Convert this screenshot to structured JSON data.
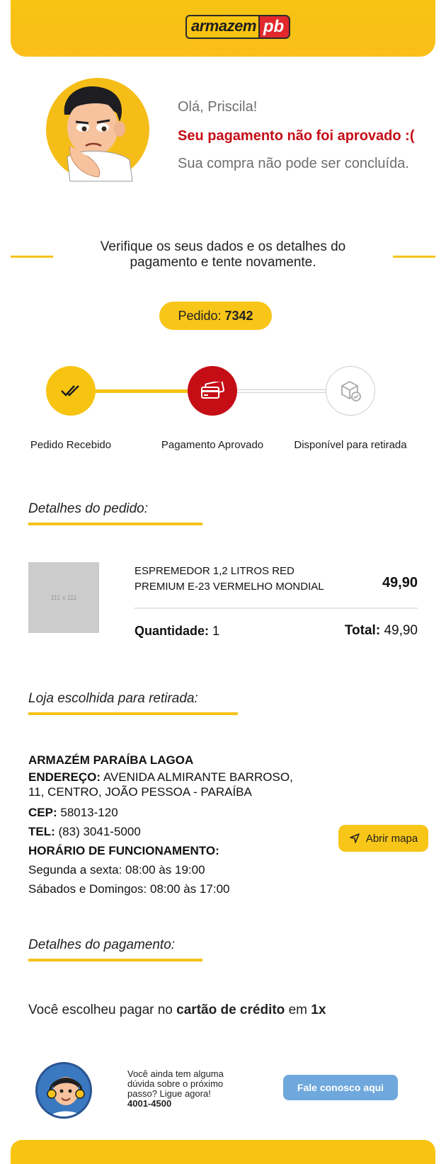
{
  "header": {
    "logo_main": "armazem",
    "logo_suffix": "pb"
  },
  "hero": {
    "greeting": "Olá, Priscila!",
    "status": "Seu pagamento não foi aprovado :(",
    "message": "Sua compra não pode ser concluída."
  },
  "notice": {
    "line1": "Verifique os seus dados e os detalhes do",
    "line2": "pagamento e tente novamente."
  },
  "order": {
    "label": "Pedido:",
    "number": "7342"
  },
  "tracking": {
    "steps": [
      {
        "label": "Pedido Recebido",
        "state": "done",
        "color": "#f7c412"
      },
      {
        "label": "Pagamento Aprovado",
        "state": "error",
        "color": "#c50d16"
      },
      {
        "label": "Disponível para retirada",
        "state": "pending",
        "color": "#ffffff"
      }
    ]
  },
  "order_details": {
    "title": "Detalhes do pedido:",
    "thumb_placeholder": "111 x 111",
    "product_line1": "ESPREMEDOR 1,2 LITROS RED",
    "product_line2": "PREMIUM E-23 VERMELHO MONDIAL",
    "price": "49,90",
    "quantity_label": "Quantidade:",
    "quantity": "1",
    "total_label": "Total:",
    "total": "49,90"
  },
  "store": {
    "title": "Loja escolhida para retirada:",
    "name": "ARMAZÉM PARAÍBA LAGOA",
    "address_label": "ENDEREÇO:",
    "address_line1": "AVENIDA ALMIRANTE BARROSO,",
    "address_line2": "11, CENTRO, JOÃO PESSOA - PARAÍBA",
    "cep_label": "CEP:",
    "cep": "58013-120",
    "tel_label": "TEL:",
    "tel": "(83) 3041-5000",
    "hours_label": "HORÁRIO DE FUNCIONAMENTO:",
    "hours_week": "Segunda a sexta: 08:00 às 19:00",
    "hours_weekend": "Sábados e Domingos: 08:00 às 17:00",
    "map_button": "Abrir mapa"
  },
  "payment": {
    "title": "Detalhes do pagamento:",
    "prefix": "Você escolheu pagar no",
    "method": "cartão de crédito",
    "middle": "em",
    "installments": "1x"
  },
  "help": {
    "line1": "Você ainda tem alguma",
    "line2": "dúvida sobre o próximo",
    "line3": "passo? Ligue agora!",
    "phone": "4001-4500",
    "button": "Fale conosco aqui"
  },
  "colors": {
    "brand_yellow": "#f7c412",
    "error_red": "#c50d16",
    "help_blue": "#6fa8dc"
  }
}
